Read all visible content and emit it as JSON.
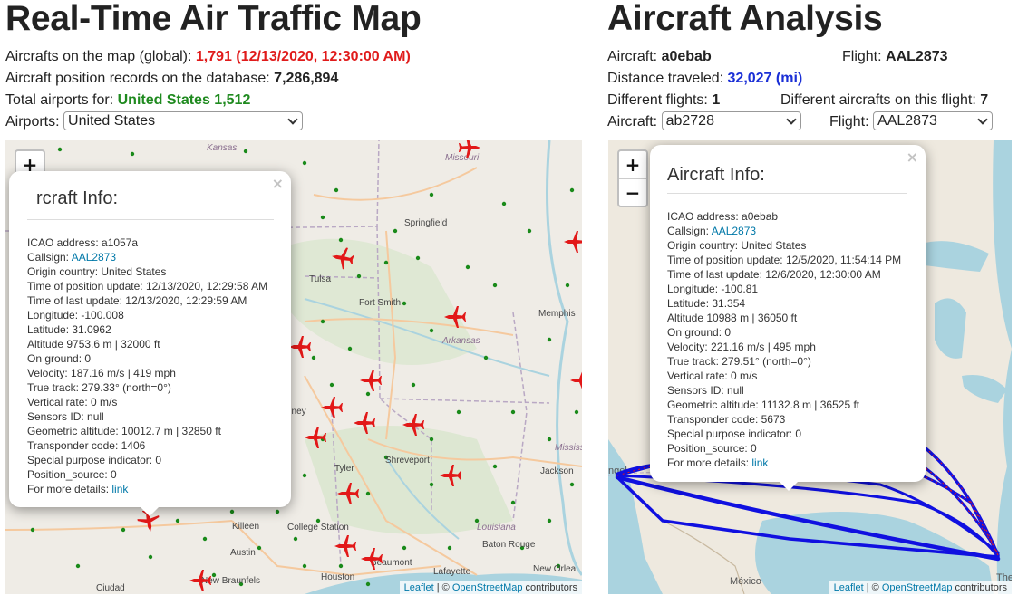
{
  "left": {
    "title": "Real-Time Air Traffic Map",
    "aircrafts_label": "Aircrafts on the map (global):",
    "aircrafts_value": "1,791 (12/13/2020, 12:30:00 AM)",
    "records_label": "Aircraft position records on the database:",
    "records_value": "7,286,894",
    "airports_total_label": "Total airports for:",
    "airports_total_value": "United States 1,512",
    "airports_select_label": "Airports:",
    "airports_select_value": "United States",
    "map": {
      "zoom_in": "+",
      "zoom_out": "−",
      "leaflet": "Leaflet",
      "attribution_sep": " | © ",
      "osm": "OpenStreetMap",
      "contributors": " contributors",
      "places": [
        "Kansas",
        "Missouri",
        "Springfield",
        "Tulsa",
        "Fort Smith",
        "Memphis",
        "Arkansas",
        "Shreveport",
        "Tyler",
        "Jackson",
        "Mississi",
        "Killeen",
        "College Station",
        "Austin",
        "New Braunfels",
        "Houston",
        "Beaumont",
        "Lafayette",
        "Baton Rouge",
        "Louisiana",
        "New Orlea",
        "Ciudad",
        "nney"
      ],
      "popup": {
        "close": "×",
        "title": "rcraft Info:",
        "lines": [
          "ICAO address: a1057a",
          "Origin country: United States",
          "Time of position update: 12/13/2020, 12:29:58 AM",
          "Time of last update: 12/13/2020, 12:29:59 AM",
          "Longitude: -100.008",
          "Latitude: 31.0962",
          "Altitude 9753.6 m | 32000 ft",
          "On ground: 0",
          "Velocity: 187.16 m/s | 419 mph",
          "True track: 279.33° (north=0°)",
          "Vertical rate: 0 m/s",
          "Sensors ID: null",
          "Geometric altitude: 10012.7 m | 32850 ft",
          "Transponder code: 1406",
          "Special purpose indicator: 0",
          "Position_source: 0"
        ],
        "callsign_label": "Callsign: ",
        "callsign_value": "AAL2873",
        "details_label": "For more details: ",
        "details_link": "link"
      }
    }
  },
  "right": {
    "title": "Aircraft Analysis",
    "aircraft_label": "Aircraft:",
    "aircraft_value": "a0ebab",
    "flight_label": "Flight:",
    "flight_value": "AAL2873",
    "distance_label": "Distance traveled:",
    "distance_value": "32,027 (mi)",
    "diff_flights_label": "Different flights:",
    "diff_flights_value": "1",
    "diff_aircrafts_label": "Different aircrafts on this flight:",
    "diff_aircrafts_value": "7",
    "aircraft_select_label": "Aircraft:",
    "aircraft_select_value": "ab2728",
    "flight_select_label": "Flight:",
    "flight_select_value": "AAL2873",
    "map": {
      "zoom_in": "+",
      "zoom_out": "−",
      "leaflet": "Leaflet",
      "attribution_sep": " | © ",
      "osm": "OpenStreetMap",
      "contributors": " contributors",
      "places": [
        "ngel",
        "México",
        "The"
      ],
      "popup": {
        "close": "×",
        "title": "Aircraft Info:",
        "lines": [
          "ICAO address: a0ebab",
          "Origin country: United States",
          "Time of position update: 12/5/2020, 11:54:14 PM",
          "Time of last update: 12/6/2020, 12:30:00 AM",
          "Longitude: -100.81",
          "Latitude: 31.354",
          "Altitude 10988 m | 36050 ft",
          "On ground: 0",
          "Velocity: 221.16 m/s | 495 mph",
          "True track: 279.51° (north=0°)",
          "Vertical rate: 0 m/s",
          "Sensors ID: null",
          "Geometric altitude: 11132.8 m | 36525 ft",
          "Transponder code: 5673",
          "Special purpose indicator: 0",
          "Position_source: 0"
        ],
        "callsign_label": "Callsign: ",
        "callsign_value": "AAL2873",
        "details_label": "For more details: ",
        "details_link": "link"
      }
    }
  },
  "colors": {
    "aircraft": "#e21818",
    "airport": "#1a8a1a",
    "track": "#1010e0",
    "link": "#0078a8"
  }
}
